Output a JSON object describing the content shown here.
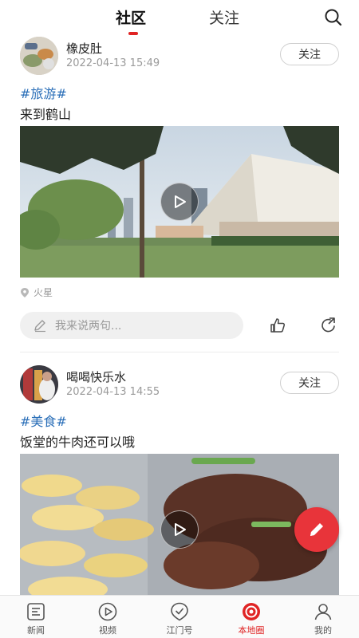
{
  "header": {
    "tabs": [
      {
        "label": "社区",
        "active": true
      },
      {
        "label": "关注",
        "active": false
      }
    ],
    "search_icon": "search-icon",
    "accent_color": "#e02424"
  },
  "posts": [
    {
      "username": "橡皮肚",
      "timestamp": "2022-04-13 15:49",
      "follow_label": "关注",
      "hashtag": "#旅游#",
      "text": "来到鹤山",
      "media_type": "video",
      "location": "火星",
      "comment_placeholder": "我来说两句..."
    },
    {
      "username": "喝喝快乐水",
      "timestamp": "2022-04-13 14:55",
      "follow_label": "关注",
      "hashtag": "#美食#",
      "text": "饭堂的牛肉还可以哦",
      "media_type": "video"
    }
  ],
  "fab": {
    "icon": "pencil-icon",
    "color": "#e8343a"
  },
  "bottom_nav": [
    {
      "label": "新闻",
      "icon": "news-icon",
      "active": false
    },
    {
      "label": "视频",
      "icon": "video-play-icon",
      "active": false
    },
    {
      "label": "江门号",
      "icon": "check-badge-icon",
      "active": false
    },
    {
      "label": "本地圈",
      "icon": "local-circle-icon",
      "active": true
    },
    {
      "label": "我的",
      "icon": "user-icon",
      "active": false
    }
  ]
}
